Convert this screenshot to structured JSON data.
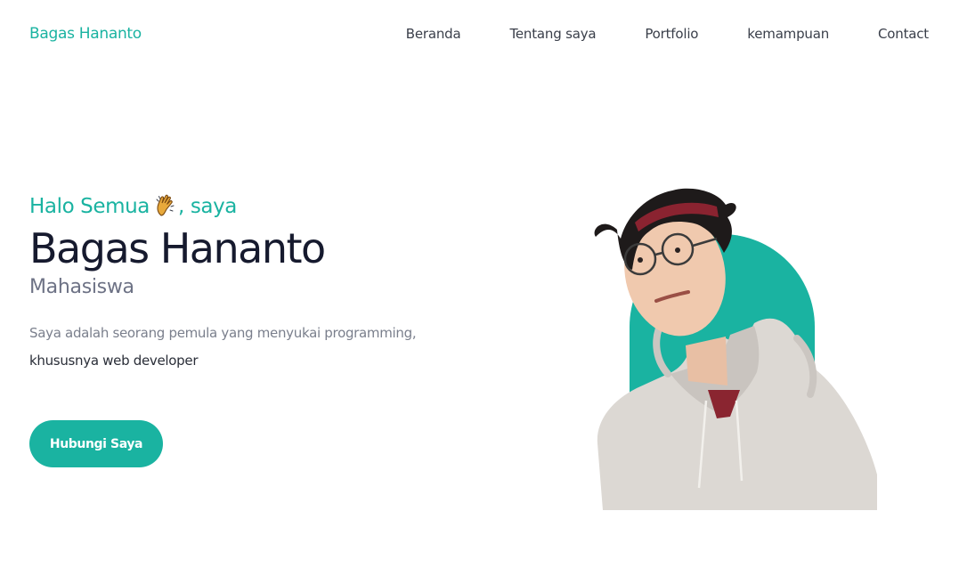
{
  "navbar": {
    "brand": "Bagas Hananto",
    "links": [
      "Beranda",
      "Tentang saya",
      "Portfolio",
      "kemampuan",
      "Contact"
    ]
  },
  "hero": {
    "greeting_before": "Halo Semua",
    "greeting_icon": "clapping-hands-icon",
    "greeting_after": ", saya",
    "name": "Bagas Hananto",
    "role": "Mahasiswa",
    "description_plain": "Saya adalah seorang pemula yang menyukai programming, ",
    "description_strong": "khususnya web developer",
    "cta_label": "Hubungi Saya"
  },
  "colors": {
    "accent": "#1ab3a1",
    "heading": "#161a2e",
    "body_text": "#7a7f8c"
  }
}
